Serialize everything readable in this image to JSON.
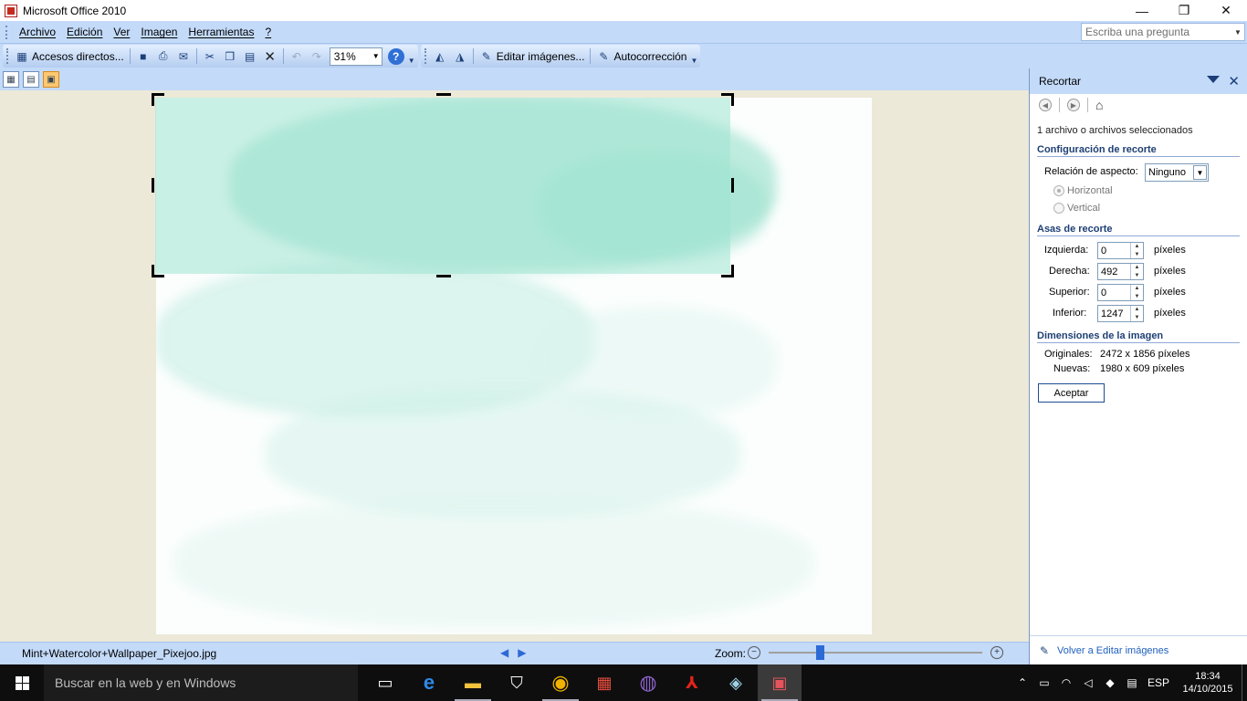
{
  "window": {
    "title": "Microsoft Office 2010",
    "minimize": "—",
    "restore": "❐",
    "close": "✕"
  },
  "menubar": {
    "items": [
      "Archivo",
      "Edición",
      "Ver",
      "Imagen",
      "Herramientas",
      "?"
    ],
    "ask_placeholder": "Escriba una pregunta"
  },
  "toolbar": {
    "shortcuts_label": "Accesos directos...",
    "zoom_value": "31%",
    "edit_images_label": "Editar imágenes...",
    "autocorrect_label": "Autocorrección"
  },
  "canvas": {
    "accent": "#a0e4d2"
  },
  "statusbar": {
    "filename": "Mint+Watercolor+Wallpaper_Pixejoo.jpg",
    "zoom_label": "Zoom:",
    "zoom_level": 0.23
  },
  "taskpane": {
    "title": "Recortar",
    "selection_info": "1 archivo o archivos seleccionados",
    "crop_config_heading": "Configuración de recorte",
    "aspect_label": "Relación de aspecto:",
    "aspect_value": "Ninguno",
    "horizontal_label": "Horizontal",
    "vertical_label": "Vertical",
    "crop_handles_heading": "Asas de recorte",
    "left_label": "Izquierda:",
    "left_value": "0",
    "right_label": "Derecha:",
    "right_value": "492",
    "top_label": "Superior:",
    "top_value": "0",
    "bottom_label": "Inferior:",
    "bottom_value": "1247",
    "unit": "píxeles",
    "dimensions_heading": "Dimensiones de la imagen",
    "original_label": "Originales:",
    "original_value": "2472 x 1856 píxeles",
    "new_label": "Nuevas:",
    "new_value": "1980 x 609 píxeles",
    "accept_label": "Aceptar",
    "back_link": "Volver a Editar imágenes"
  },
  "taskbar": {
    "search_placeholder": "Buscar en la web y en Windows",
    "language": "ESP",
    "time": "18:34",
    "date": "14/10/2015"
  }
}
